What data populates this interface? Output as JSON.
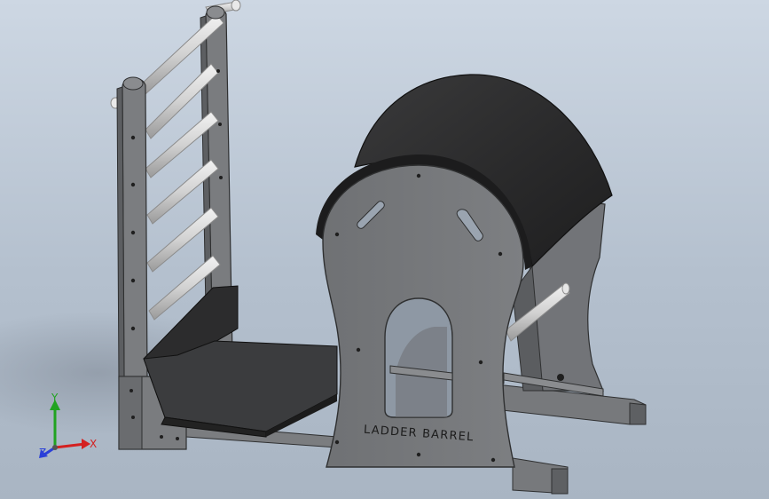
{
  "model": {
    "engraved_label": "LADDER BARREL"
  },
  "triad": {
    "x_label": "X",
    "y_label": "Y",
    "z_label": "Z",
    "x_color": "#d42020",
    "y_color": "#21a321",
    "z_color": "#2a3fd8"
  },
  "colors": {
    "background_top": "#cdd7e3",
    "background_bottom": "#a9b5c3",
    "frame_gray": "#77797c",
    "frame_dark": "#3a3b3d",
    "rung_light": "#d5d5d5",
    "pad_black": "#2b2b2c"
  }
}
